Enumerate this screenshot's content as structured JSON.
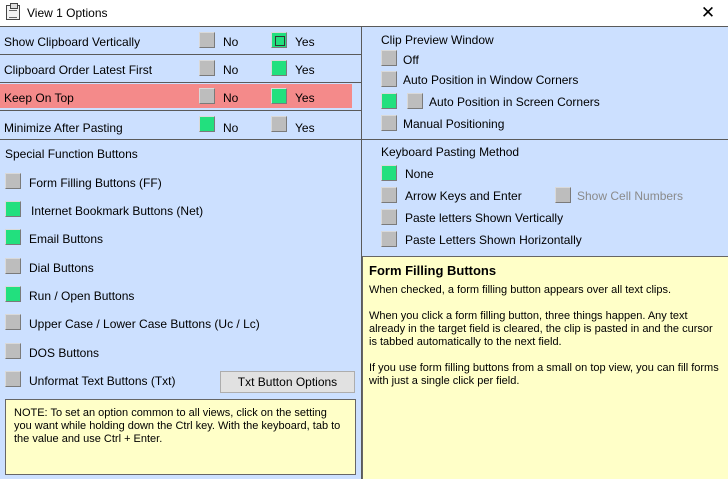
{
  "window": {
    "title": "View 1 Options",
    "close_glyph": "✕",
    "icon": "clipboard-icon"
  },
  "options": [
    {
      "label": "Show Clipboard Vertically",
      "no_label": "No",
      "yes_label": "Yes",
      "selected": "yes-highlighted"
    },
    {
      "label": "Clipboard Order Latest First",
      "no_label": "No",
      "yes_label": "Yes",
      "selected": "yes"
    },
    {
      "label": "Keep On Top",
      "no_label": "No",
      "yes_label": "Yes",
      "selected": "yes"
    },
    {
      "label": "Minimize After Pasting",
      "no_label": "No",
      "yes_label": "Yes",
      "selected": "no"
    }
  ],
  "special": {
    "heading": "Special Function Buttons",
    "items": [
      {
        "label": "Form Filling Buttons (FF)",
        "checked": false
      },
      {
        "label": "Internet Bookmark Buttons (Net)",
        "checked": true
      },
      {
        "label": "Email Buttons",
        "checked": true
      },
      {
        "label": "Dial Buttons",
        "checked": false
      },
      {
        "label": "Run / Open Buttons",
        "checked": true
      },
      {
        "label": "Upper Case / Lower Case Buttons (Uc / Lc)",
        "checked": false
      },
      {
        "label": "DOS Buttons",
        "checked": false
      },
      {
        "label": "Unformat Text Buttons (Txt)",
        "checked": false
      }
    ],
    "txt_button": "Txt Button Options"
  },
  "note": "NOTE:  To set an option common to all views, click on the setting you want while holding down the Ctrl key. With the keyboard, tab to the value and use Ctrl + Enter.",
  "clip_preview": {
    "heading": "Clip Preview Window",
    "items": [
      {
        "label": "Off",
        "checked": false
      },
      {
        "label": "Auto Position in Window Corners",
        "checked": false
      },
      {
        "label": "Auto Position in Screen Corners",
        "checked": true
      },
      {
        "label": "Manual Positioning",
        "checked": false
      }
    ]
  },
  "keyboard": {
    "heading": "Keyboard Pasting Method",
    "items": [
      {
        "label": "None",
        "checked": true
      },
      {
        "label": "Arrow Keys and Enter",
        "checked": false
      },
      {
        "label": "Paste letters Shown Vertically",
        "checked": false
      },
      {
        "label": "Paste Letters Shown Horizontally",
        "checked": false
      }
    ],
    "show_cell_numbers": "Show Cell Numbers"
  },
  "help": {
    "title": "Form Filling Buttons",
    "paragraphs": [
      "When checked, a form filling button appears over all text clips.",
      "When you click a form filling button, three things happen. Any text already in the target field is cleared, the clip is pasted in and the cursor is tabbed automatically to the next field.",
      "If you use form filling buttons from a small on top view, you can fill forms with just a single click per field."
    ]
  },
  "colors": {
    "panel": "#cce0ff",
    "checked": "#22e07e",
    "highlight_row": "#f48a8a",
    "help_bg": "#ffffc8"
  }
}
